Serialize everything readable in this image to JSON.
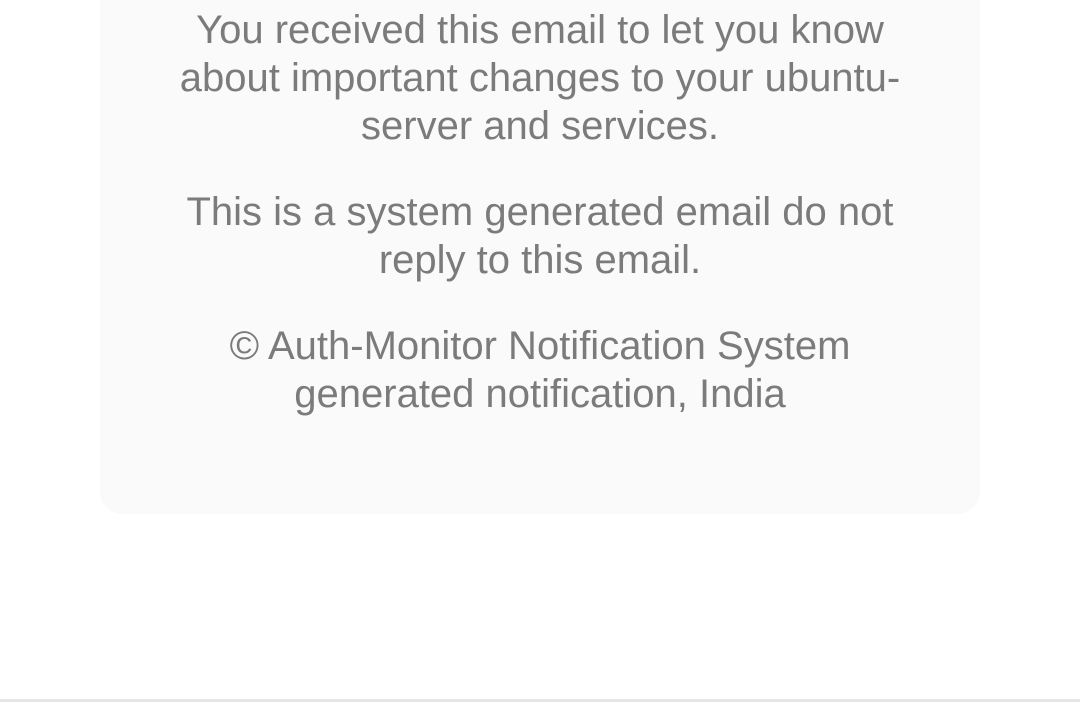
{
  "email_footer": {
    "notice_text": "You received this email to let you know about important changes to your ubuntu-server and services.",
    "no_reply_text": "This is a system generated email do not reply to this email.",
    "copyright_text": "© Auth-Monitor Notification System generated notification, India"
  },
  "colors": {
    "page_background": "#ffffff",
    "card_background": "#fafafa",
    "footer_text": "#7b7b7b",
    "divider": "#e6e6e6"
  }
}
